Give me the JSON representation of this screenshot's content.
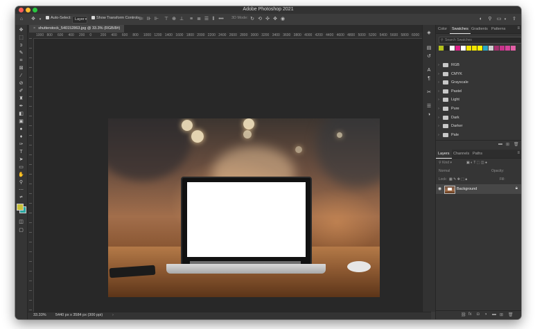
{
  "app": {
    "title": "Adobe Photoshop 2021"
  },
  "options_bar": {
    "auto_select_label": "Auto-Select:",
    "auto_select_target": "Layer",
    "show_transform_label": "Show Transform Controls",
    "mode_3d_label": "3D Mode:"
  },
  "document": {
    "tab_title": "shutterstock_540152863.jpg @ 33.3% (RGB/8#)"
  },
  "rulers": {
    "top_ticks": [
      "1000",
      "800",
      "600",
      "400",
      "200",
      "0",
      "200",
      "400",
      "600",
      "800",
      "1000",
      "1200",
      "1400",
      "1600",
      "1800",
      "2000",
      "2200",
      "2400",
      "2600",
      "2800",
      "3000",
      "3200",
      "3400",
      "3600",
      "3800",
      "4000",
      "4200",
      "4400",
      "4600",
      "4800",
      "5000",
      "5200",
      "5400",
      "5600",
      "5800",
      "6000",
      "6200"
    ]
  },
  "status_bar": {
    "zoom": "33.33%",
    "doc_size": "5440 px x 3584 px (300 ppi)"
  },
  "colors": {
    "foreground": "#c9c13a",
    "background": "#2aa6a0",
    "accent": "#ececec"
  },
  "tools": [
    "move-tool",
    "marquee-tool",
    "lasso-tool",
    "quick-selection-tool",
    "crop-tool",
    "frame-tool",
    "eyedropper-tool",
    "healing-brush-tool",
    "brush-tool",
    "clone-stamp-tool",
    "history-brush-tool",
    "eraser-tool",
    "gradient-tool",
    "blur-tool",
    "dodge-tool",
    "pen-tool",
    "type-tool",
    "path-selection-tool",
    "rectangle-tool",
    "hand-tool",
    "zoom-tool",
    "more-tools"
  ],
  "swatches_panel": {
    "tabs": [
      {
        "label": "Color",
        "active": false
      },
      {
        "label": "Swatches",
        "active": true
      },
      {
        "label": "Gradients",
        "active": false
      },
      {
        "label": "Patterns",
        "active": false
      }
    ],
    "search_placeholder": "Search Swatches",
    "recent_swatches": [
      "#b5c21b",
      "#222222",
      "#ffffff",
      "#e0218a",
      "#ffffff",
      "#f5e400",
      "#f2e600",
      "#fff200",
      "#2aa6c4",
      "#cfcfcf",
      "#a4306e",
      "#c7338b",
      "#d6439b",
      "#e25fa6"
    ],
    "groups": [
      "RGB",
      "CMYK",
      "Grayscale",
      "Pastel",
      "Light",
      "Pure",
      "Dark",
      "Darker",
      "Pale"
    ]
  },
  "layers_panel": {
    "tabs": [
      {
        "label": "Layers",
        "active": true
      },
      {
        "label": "Channels",
        "active": false
      },
      {
        "label": "Paths",
        "active": false
      }
    ],
    "kind_filter": "Kind",
    "blend_mode": "Normal",
    "opacity_label": "Opacity:",
    "lock_label": "Lock:",
    "fill_label": "Fill:",
    "layers": [
      {
        "name": "Background",
        "visible": true,
        "locked": true
      }
    ]
  }
}
